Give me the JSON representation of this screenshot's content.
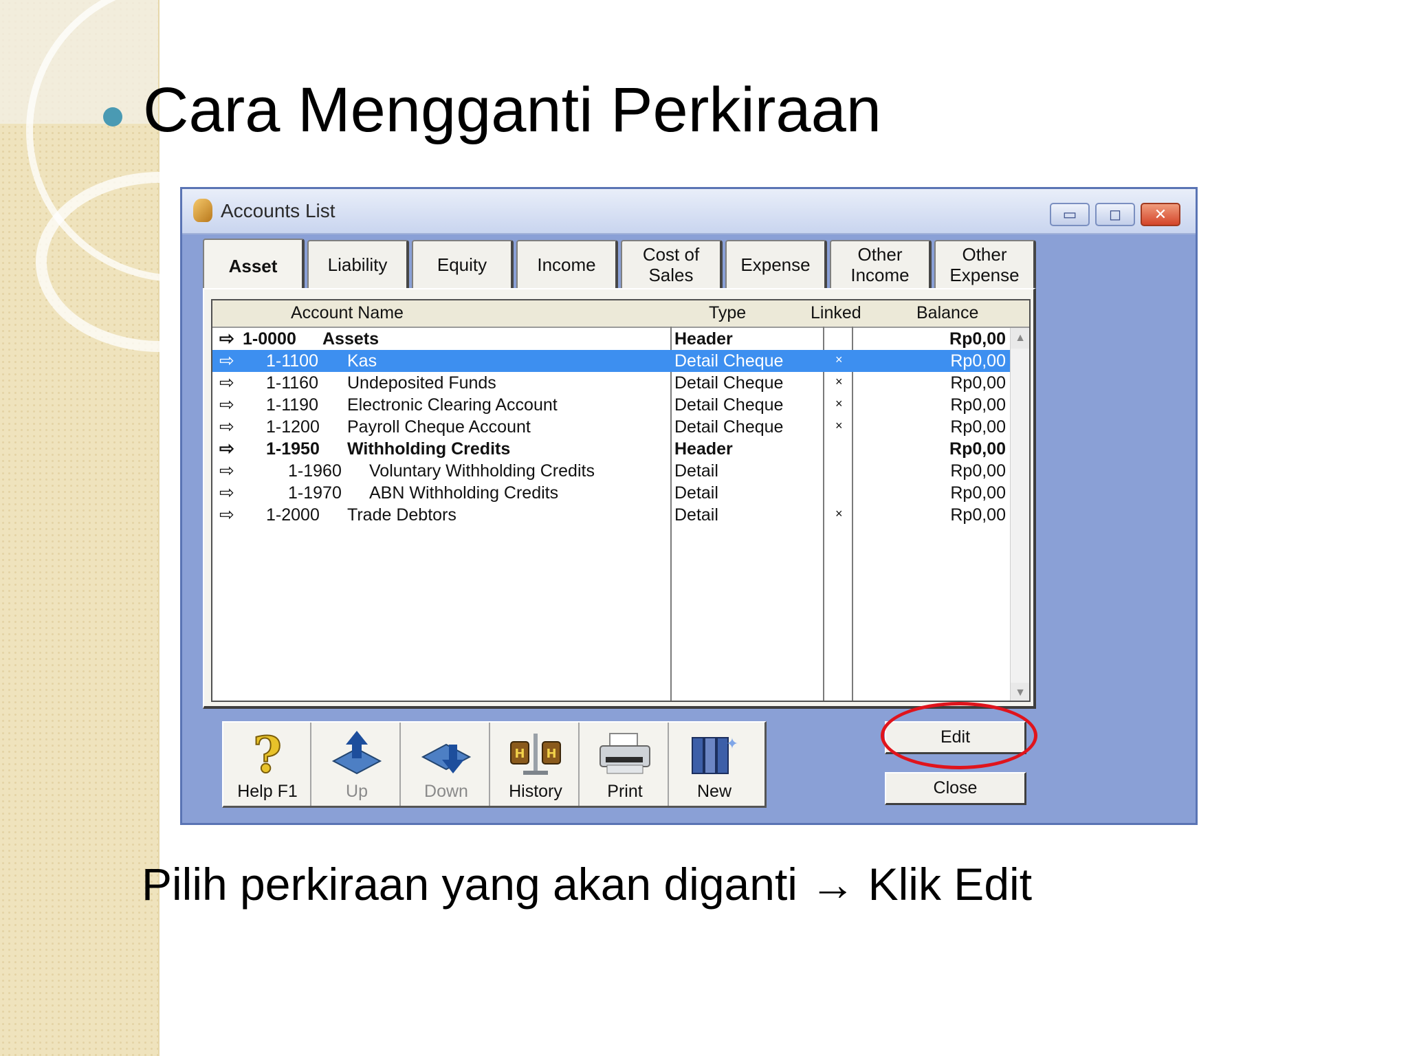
{
  "slide": {
    "title": "Cara Mengganti Perkiraan",
    "caption": "Pilih perkiraan yang akan diganti → Klik Edit"
  },
  "window": {
    "title": "Accounts List",
    "controls": {
      "minimize": "▭",
      "maximize": "◻",
      "close": "✕"
    }
  },
  "tabs": [
    {
      "label": "Asset",
      "active": true
    },
    {
      "label": "Liability"
    },
    {
      "label": "Equity"
    },
    {
      "label": "Income"
    },
    {
      "label": "Cost of Sales"
    },
    {
      "label": "Expense"
    },
    {
      "label": "Other Income"
    },
    {
      "label": "Other Expense"
    }
  ],
  "columns": {
    "account_name": "Account Name",
    "type": "Type",
    "linked": "Linked",
    "balance": "Balance"
  },
  "rows": [
    {
      "code": "1-0000",
      "name": "Assets",
      "type": "Header",
      "linked": "",
      "balance": "Rp0,00",
      "bold": true,
      "level": 0
    },
    {
      "code": "1-1100",
      "name": "Kas",
      "type": "Detail Cheque",
      "linked": "×",
      "balance": "Rp0,00",
      "level": 1,
      "selected": true
    },
    {
      "code": "1-1160",
      "name": "Undeposited Funds",
      "type": "Detail Cheque",
      "linked": "×",
      "balance": "Rp0,00",
      "level": 1
    },
    {
      "code": "1-1190",
      "name": "Electronic Clearing Account",
      "type": "Detail Cheque",
      "linked": "×",
      "balance": "Rp0,00",
      "level": 1
    },
    {
      "code": "1-1200",
      "name": "Payroll Cheque Account",
      "type": "Detail Cheque",
      "linked": "×",
      "balance": "Rp0,00",
      "level": 1
    },
    {
      "code": "1-1950",
      "name": "Withholding Credits",
      "type": "Header",
      "linked": "",
      "balance": "Rp0,00",
      "bold": true,
      "level": 1
    },
    {
      "code": "1-1960",
      "name": "Voluntary Withholding Credits",
      "type": "Detail",
      "linked": "",
      "balance": "Rp0,00",
      "level": 2
    },
    {
      "code": "1-1970",
      "name": "ABN Withholding Credits",
      "type": "Detail",
      "linked": "",
      "balance": "Rp0,00",
      "level": 2
    },
    {
      "code": "1-2000",
      "name": "Trade Debtors",
      "type": "Detail",
      "linked": "×",
      "balance": "Rp0,00",
      "level": 1
    }
  ],
  "row_arrow": "⇨",
  "toolbar": [
    {
      "name": "help",
      "label": "Help F1",
      "icon": "question-icon"
    },
    {
      "name": "up",
      "label": "Up",
      "icon": "up-arrow-icon",
      "disabled": true
    },
    {
      "name": "down",
      "label": "Down",
      "icon": "down-arrow-icon",
      "disabled": true
    },
    {
      "name": "history",
      "label": "History",
      "icon": "history-scale-icon"
    },
    {
      "name": "print",
      "label": "Print",
      "icon": "printer-icon"
    },
    {
      "name": "new",
      "label": "New",
      "icon": "new-book-icon"
    }
  ],
  "buttons": {
    "edit": "Edit",
    "close": "Close"
  },
  "colors": {
    "selection": "#3d8ff0",
    "window_bg": "#8aa0d6",
    "highlight": "#e0141c",
    "bullet": "#4a9ab3"
  }
}
